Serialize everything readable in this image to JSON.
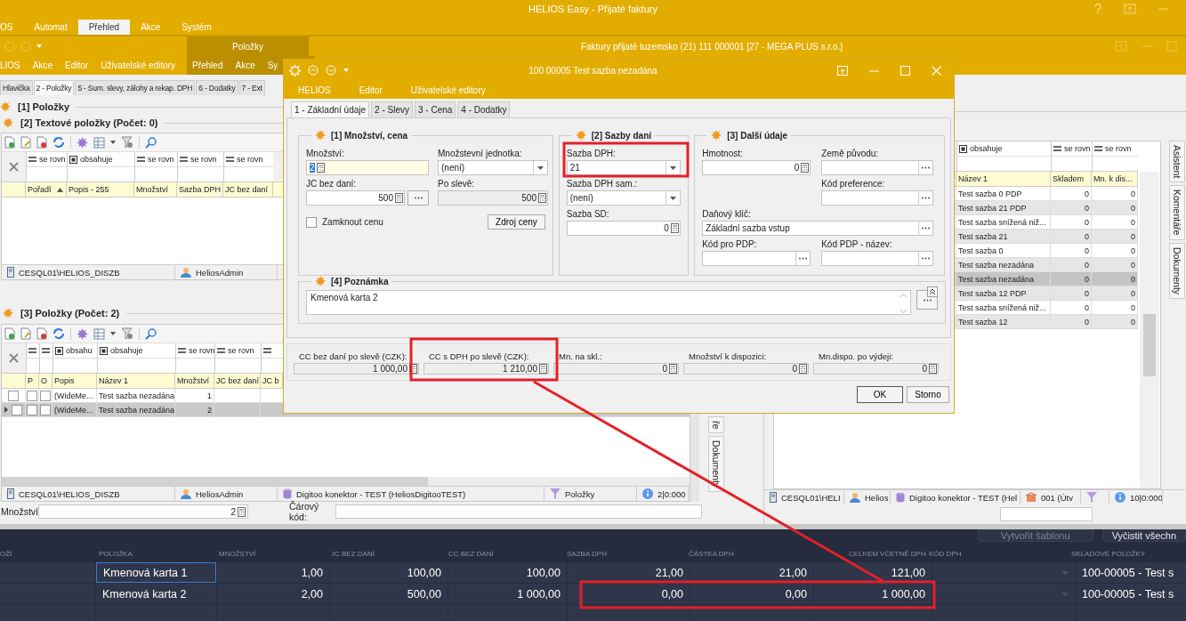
{
  "app_window": {
    "title": "HELIOS Easy - Přijaté faktury",
    "menu": [
      {
        "label": "OS",
        "selected": false
      },
      {
        "label": "Automat",
        "selected": false
      },
      {
        "label": "Přehled",
        "selected": true
      },
      {
        "label": "Akce",
        "selected": false
      },
      {
        "label": "Systém",
        "selected": false
      }
    ]
  },
  "document_window": {
    "title": "Faktury přijaté tuzemsko (21)  111 000001 [27 - MEGA PLUS s.r.o.]",
    "context_tab": "Položky",
    "menu": [
      "LIOS",
      "Akce",
      "Editor",
      "Uživatelské editory"
    ],
    "context_menu": [
      "Přehled",
      "Akce",
      "Sy"
    ],
    "tabs": [
      {
        "label": "Hlavička",
        "selected": false
      },
      {
        "label": "2 - Položky",
        "selected": true
      },
      {
        "label": "5 - Sum. slevy, zálohy a rekap. DPH",
        "selected": false
      },
      {
        "label": "6 - Dodatky",
        "selected": false
      },
      {
        "label": "7 - Ext",
        "selected": false
      }
    ]
  },
  "left_pane": {
    "heading": "[1] Položky",
    "text_items": {
      "title": "[2] Textové položky (Počet: 0)",
      "filters": [
        {
          "kind": "equals",
          "text": "se rovn"
        },
        {
          "kind": "contains",
          "text": "obsahuje"
        },
        {
          "kind": "equals",
          "text": "se rovn"
        },
        {
          "kind": "equals",
          "text": "se rovn"
        },
        {
          "kind": "equals",
          "text": "se rovn"
        }
      ],
      "columns": [
        "Pořadí",
        "Popis - 255",
        "Množství",
        "Sazba DPH",
        "JC bez daní"
      ],
      "status_bar": [
        {
          "kind": "server",
          "text": "CESQL01\\HELIOS_DISZB"
        },
        {
          "kind": "user",
          "text": "HeliosAdmin"
        }
      ]
    },
    "items": {
      "title": "[3] Položky (Počet: 2)",
      "filters": [
        {
          "kind": "equals"
        },
        {
          "kind": "equals"
        },
        {
          "kind": "contains",
          "text": "obsahu"
        },
        {
          "kind": "contains",
          "text": "obsahuje"
        },
        {
          "kind": "equals",
          "text": "se rovn"
        },
        {
          "kind": "equals",
          "text": "se rovn"
        },
        {
          "kind": "equals"
        }
      ],
      "columns": [
        "P",
        "O",
        "Popis",
        "Název 1",
        "Množství",
        "JC bez daní",
        "JC b"
      ],
      "rows": [
        {
          "selected": false,
          "checked": false,
          "p": false,
          "o": false,
          "description": "(WideMe...",
          "name": "Test sazba nezadána",
          "quantity": "1"
        },
        {
          "selected": true,
          "checked": false,
          "p": false,
          "o": false,
          "description": "(WideMe...",
          "name": "Test sazba nezadána",
          "quantity": "2"
        }
      ],
      "status_bar": [
        {
          "kind": "server",
          "text": "CESQL01\\HELIOS_DISZB"
        },
        {
          "kind": "user",
          "text": "HeliosAdmin"
        },
        {
          "kind": "database",
          "text": "Digitoo konektor - TEST (HeliosDigitooTEST)"
        },
        {
          "kind": "filter",
          "text": "Položky"
        },
        {
          "kind": "info",
          "text": "2|0:000"
        }
      ]
    },
    "side_tabs": [
      "ře",
      "Dokumenty"
    ],
    "quantity_field": {
      "label": "Množství:",
      "value": "2"
    },
    "barcode_field": {
      "label": "Čárový kód:"
    }
  },
  "right_pane": {
    "filters": [
      {
        "kind": "contains",
        "text": "obsahuje"
      },
      {
        "kind": "equals",
        "text": "se rovn"
      },
      {
        "kind": "equals",
        "text": "se rovn"
      }
    ],
    "columns": [
      "Název 1",
      "Skladem",
      "Mn. k dis..."
    ],
    "rows": [
      {
        "name": "Test sazba 0 PDP",
        "stock": "0",
        "available": "0",
        "selected": false
      },
      {
        "name": "Test sazba 21 PDP",
        "stock": "0",
        "available": "0",
        "selected": false
      },
      {
        "name": "Test sazba snížená niž...",
        "stock": "0",
        "available": "0",
        "selected": false
      },
      {
        "name": "Test sazba 21",
        "stock": "0",
        "available": "0",
        "selected": false
      },
      {
        "name": "Test sazba 0",
        "stock": "0",
        "available": "0",
        "selected": false
      },
      {
        "name": "Test sazba nezadána",
        "stock": "0",
        "available": "0",
        "selected": false
      },
      {
        "name": "Test sazba nezadána",
        "stock": "0",
        "available": "0",
        "selected": true
      },
      {
        "name": "Test sazba 12 PDP",
        "stock": "0",
        "available": "0",
        "selected": false
      },
      {
        "name": "Test sazba snížená niž...",
        "stock": "0",
        "available": "0",
        "selected": false
      },
      {
        "name": "Test sazba 12",
        "stock": "0",
        "available": "0",
        "selected": false
      }
    ],
    "side_tabs": [
      "Asistent",
      "Komentáře",
      "Dokumenty"
    ],
    "status_bar": [
      {
        "kind": "server",
        "text": "CESQL01\\HELI"
      },
      {
        "kind": "user",
        "text": "Helios"
      },
      {
        "kind": "database",
        "text": "Digitoo konektor - TEST (Hel"
      },
      {
        "kind": "building",
        "text": "001 (Útv"
      },
      {
        "kind": "filter"
      },
      {
        "kind": "info",
        "text": "10|0:000"
      }
    ]
  },
  "dialog": {
    "title": "100 00005 Test sazba nezadána",
    "menu": [
      "HELIOS",
      "Editor",
      "Uživatelské editory"
    ],
    "tabs": [
      {
        "label": "1 - Základní údaje",
        "selected": true
      },
      {
        "label": "2 - Slevy",
        "selected": false
      },
      {
        "label": "3 - Cena",
        "selected": false
      },
      {
        "label": "4 - Dodatky",
        "selected": false
      }
    ],
    "groups": [
      {
        "title": "[1] Množství, cena",
        "fields": [
          {
            "label": "Množství:",
            "value": "2",
            "kind": "number",
            "focused": true,
            "readonly": false
          },
          {
            "label": "Množstevní jednotka:",
            "value": "(není)",
            "kind": "dropdown",
            "focused": false,
            "readonly": false
          },
          {
            "label": "JC bez daní:",
            "value": "500",
            "kind": "number_lookup",
            "focused": false,
            "readonly": false
          },
          {
            "label": "Po slevě:",
            "value": "500",
            "kind": "number",
            "focused": false,
            "readonly": true
          }
        ],
        "checkbox": {
          "label": "Zamknout cenu",
          "checked": false
        },
        "button": "Zdroj ceny"
      },
      {
        "title": "[2] Sazby daní",
        "fields": [
          {
            "label": "Sazba DPH:",
            "value": "21",
            "kind": "dropdown",
            "focused": false,
            "readonly": false
          },
          {
            "label": "Sazba DPH sam.:",
            "value": "(není)",
            "kind": "dropdown",
            "focused": false,
            "readonly": false
          },
          {
            "label": "Sazba SD:",
            "value": "0",
            "kind": "number",
            "focused": false,
            "readonly": false
          }
        ]
      },
      {
        "title": "[3] Další údaje",
        "fields": [
          {
            "label": "Hmotnost:",
            "value": "0",
            "kind": "number",
            "focused": false,
            "readonly": false
          },
          {
            "label": "Země původu:",
            "kind": "lookup",
            "focused": false,
            "readonly": false
          },
          {
            "label": "Kód preference:",
            "kind": "lookup",
            "focused": false,
            "readonly": false
          },
          {
            "label": "Daňový klíč:",
            "value": "Základní sazba vstup",
            "kind": "lookup",
            "focused": false,
            "readonly": false
          },
          {
            "label": "Kód pro PDP:",
            "kind": "lookup",
            "focused": false,
            "readonly": false
          },
          {
            "label": "Kód PDP - název:",
            "kind": "lookup",
            "focused": false,
            "readonly": false
          }
        ]
      }
    ],
    "note": {
      "title": "[4] Poznámka",
      "value": "Kmenová karta 2"
    },
    "summary": [
      {
        "label": "CC bez daní po slevě (CZK):",
        "value": "1 000,00",
        "kind": "number",
        "focused": false,
        "readonly": true
      },
      {
        "label": "CC s DPH po slevě (CZK):",
        "value": "1 210,00",
        "kind": "number",
        "focused": false,
        "readonly": true
      },
      {
        "label": "Mn. na skl.:",
        "value": "0",
        "kind": "number",
        "focused": false,
        "readonly": true
      },
      {
        "label": "Množství k dispozici:",
        "value": "0",
        "kind": "number",
        "focused": false,
        "readonly": true
      },
      {
        "label": "Mn.dispo. po výdeji:",
        "value": "0",
        "kind": "number",
        "focused": false,
        "readonly": true
      }
    ],
    "buttons": [
      "OK",
      "Storno"
    ]
  },
  "web_table": {
    "buttons": [
      {
        "label": "Vytvořit šablonu",
        "disabled": true
      },
      {
        "label": "Vyčistit všechn",
        "disabled": false
      }
    ],
    "columns": [
      "OŽÍ",
      "POLOŽKA",
      "MNOŽSTVÍ",
      "JC BEZ DANÍ",
      "CC BEZ DANÍ",
      "SAZBA DPH",
      "ČÁSTKA DPH",
      "CELKEM VČETNĚ DPH",
      "KÓD DPH",
      "SKLADOVÉ POLOŽKY"
    ],
    "rows": [
      {
        "focused": true,
        "item": "Kmenová karta 1",
        "quantity": "1,00",
        "unit_price": "100,00",
        "total": "100,00",
        "vat_rate": "21,00",
        "vat_amount": "21,00",
        "total_with_vat": "121,00",
        "stock_item": "100-00005 - Test s"
      },
      {
        "focused": false,
        "item": "Kmenová karta 2",
        "quantity": "2,00",
        "unit_price": "500,00",
        "total": "1 000,00",
        "vat_rate": "0,00",
        "vat_amount": "0,00",
        "total_with_vat": "1 000,00",
        "stock_item": "100-00005 - Test s"
      }
    ]
  }
}
